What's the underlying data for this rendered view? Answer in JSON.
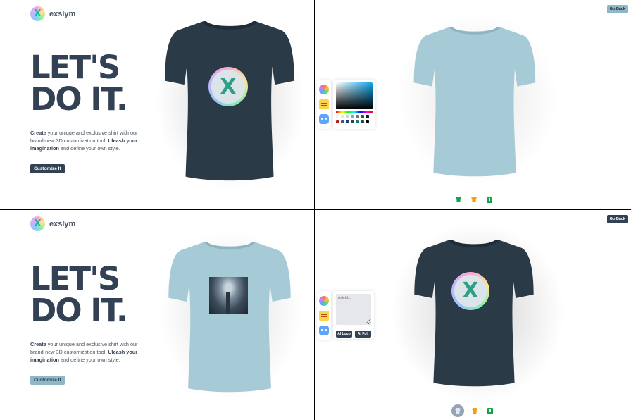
{
  "brand": {
    "name": "exslym",
    "logo_letter": "X"
  },
  "hero": {
    "line1": "LET'S",
    "line2": "DO IT.",
    "desc_bold1": "Create",
    "desc_text1": " your unique and exclusive shirt with our brand-new 3D customization tool. ",
    "desc_bold2": "Uleash your imagination",
    "desc_text2": " and define your own style.",
    "cta_label": "Customize It"
  },
  "customizer": {
    "go_back_label": "Go Back",
    "ai_placeholder": "Ask AI...",
    "ai_logo_label": "AI Logo",
    "ai_full_label": "AI Full"
  },
  "colors": {
    "dark_shirt": "#2b3a47",
    "light_shirt": "#a7cbd6",
    "accent_dark": "#334155",
    "accent_light": "#8fb8c6"
  },
  "swatches": [
    "#ffffff",
    "#e5e7eb",
    "#d1d5db",
    "#9ca3af",
    "#6b7280",
    "#166534",
    "#111827",
    "#b91c1c",
    "#475569",
    "#1e3a8a",
    "#334155",
    "#0f766e",
    "#14532d",
    "#000000"
  ],
  "icons": {
    "side_tabs": [
      "color-picker-icon",
      "file-picker-icon",
      "ai-picker-icon"
    ],
    "bottom_tabs": [
      "logo-shirt-icon",
      "full-shirt-icon",
      "download-icon"
    ]
  }
}
